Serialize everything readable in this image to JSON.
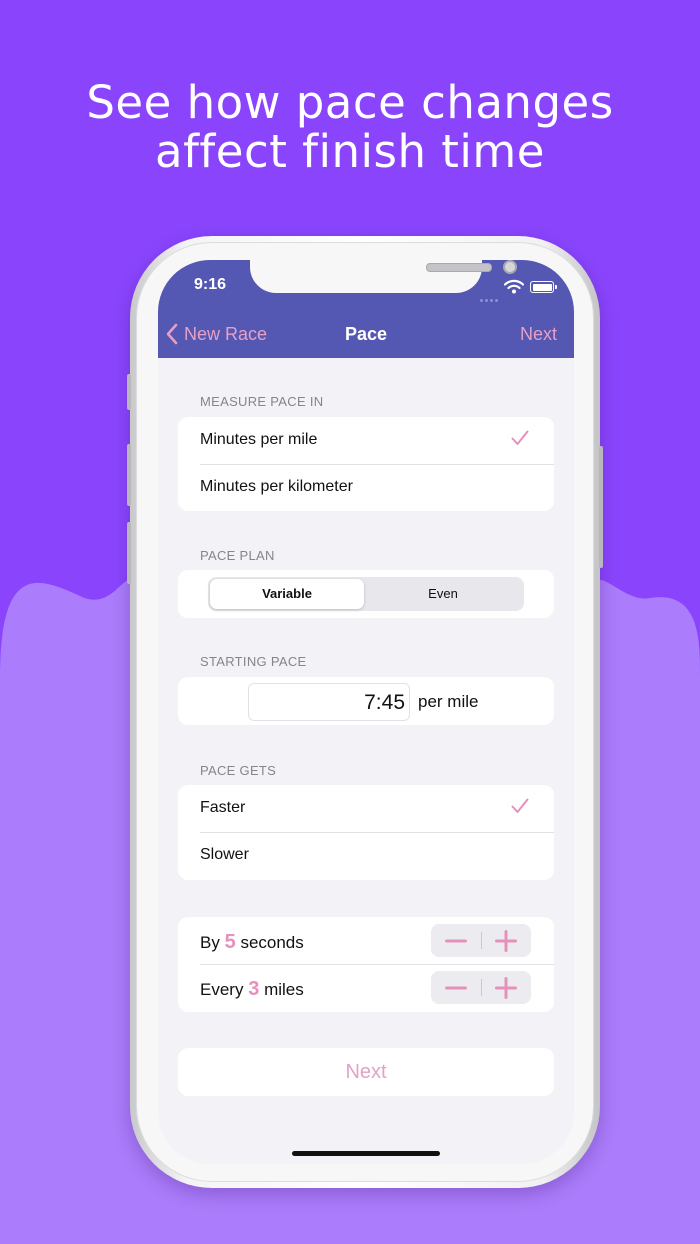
{
  "headline": {
    "line1": "See how pace changes",
    "line2": "affect finish time"
  },
  "colors": {
    "background_top": "#8a45fc",
    "background_bottom": "#ab7cfb",
    "navbar": "#5558b2",
    "accent_pink": "#e690bd"
  },
  "status_bar": {
    "time": "9:16",
    "icons": [
      "signal-icon",
      "wifi-icon",
      "battery-icon"
    ]
  },
  "nav": {
    "back_label": "New Race",
    "title": "Pace",
    "next_label": "Next"
  },
  "measure_pace": {
    "header": "MEASURE PACE IN",
    "options": [
      {
        "label": "Minutes per mile",
        "selected": true
      },
      {
        "label": "Minutes per kilometer",
        "selected": false
      }
    ]
  },
  "pace_plan": {
    "header": "PACE PLAN",
    "segments": [
      "Variable",
      "Even"
    ],
    "selected": "Variable"
  },
  "starting_pace": {
    "header": "STARTING PACE",
    "value": "7:45",
    "unit": "per mile"
  },
  "pace_gets": {
    "header": "PACE GETS",
    "options": [
      {
        "label": "Faster",
        "selected": true
      },
      {
        "label": "Slower",
        "selected": false
      }
    ]
  },
  "change": {
    "by": {
      "prefix": "By",
      "value": "5",
      "suffix": "seconds"
    },
    "every": {
      "prefix": "Every",
      "value": "3",
      "suffix": "miles"
    }
  },
  "footer": {
    "next_label": "Next"
  }
}
